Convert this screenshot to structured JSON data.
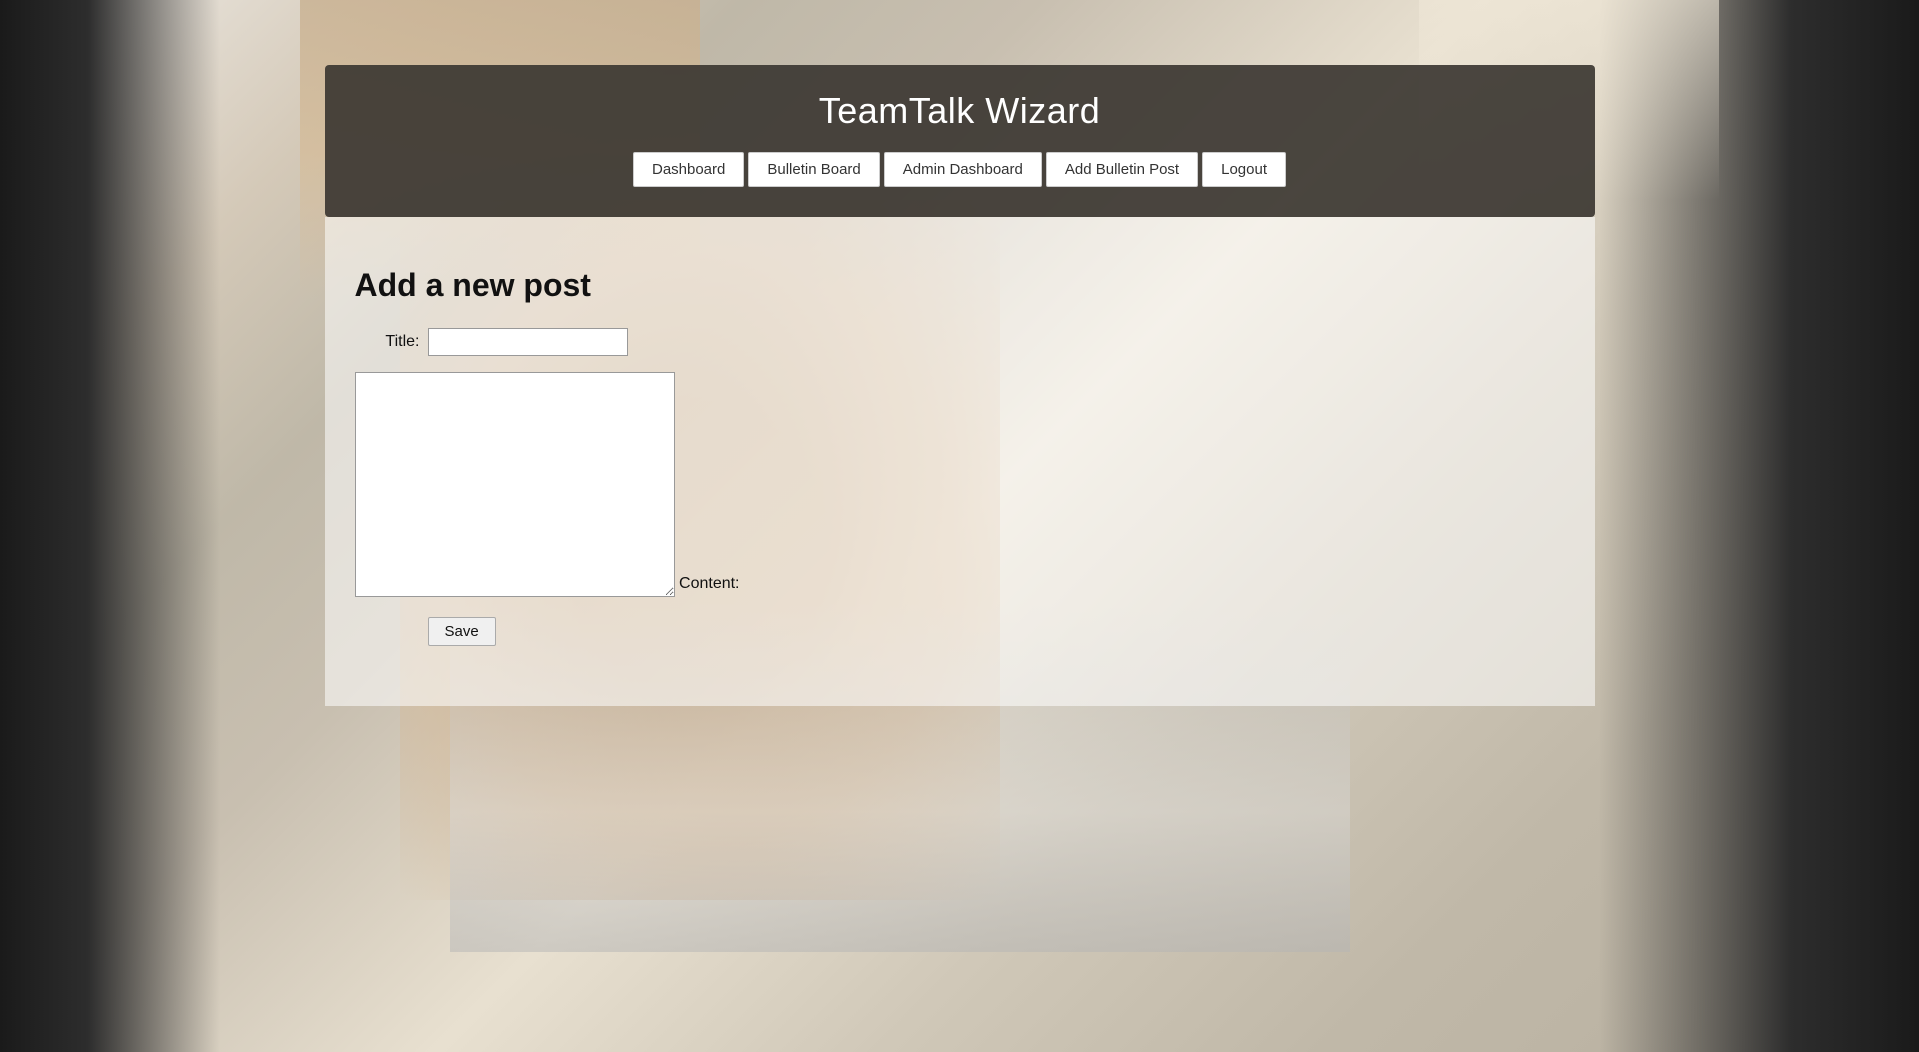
{
  "header": {
    "title": "TeamTalk Wizard",
    "nav": {
      "dashboard_label": "Dashboard",
      "bulletin_board_label": "Bulletin Board",
      "admin_dashboard_label": "Admin Dashboard",
      "add_bulletin_post_label": "Add Bulletin Post",
      "logout_label": "Logout"
    }
  },
  "main": {
    "page_heading": "Add a new post",
    "form": {
      "title_label": "Title:",
      "title_placeholder": "",
      "content_label": "Content:",
      "content_placeholder": "",
      "save_label": "Save"
    }
  }
}
